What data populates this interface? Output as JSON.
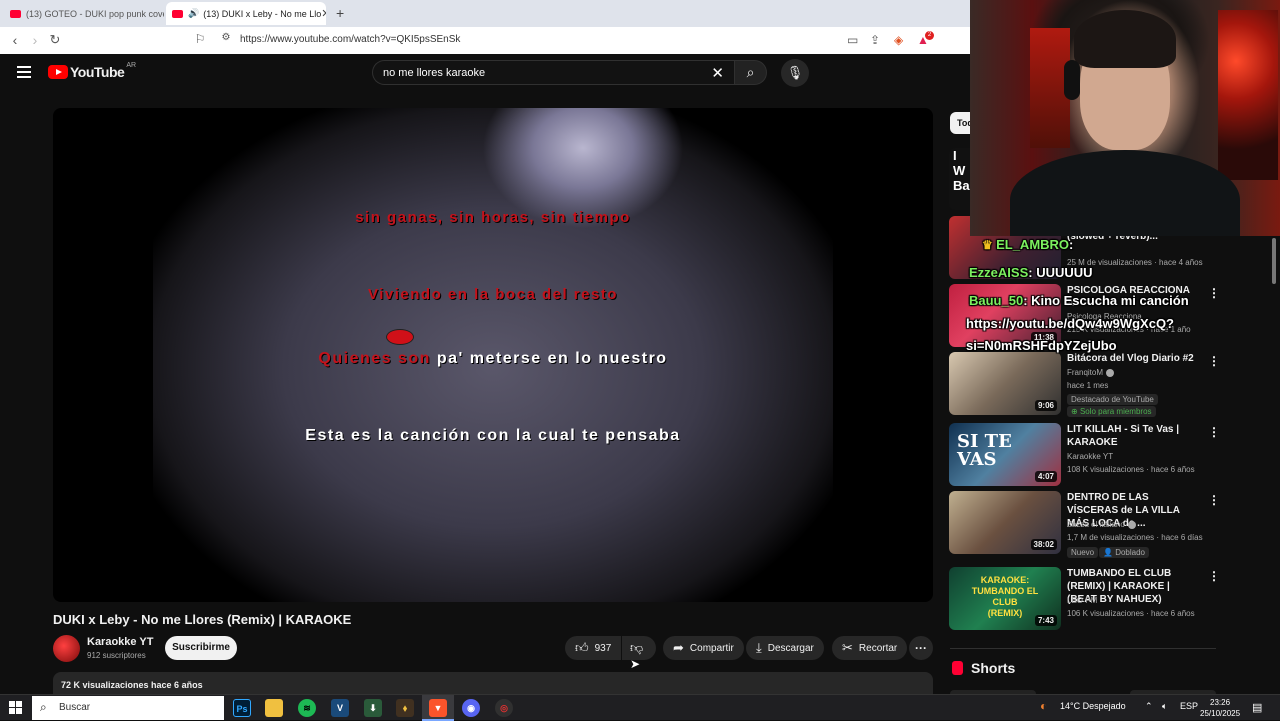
{
  "browser": {
    "tabs": [
      {
        "label": "(13) GOTEO - DUKI pop punk cover"
      },
      {
        "label": "(13) DUKI x Leby - No me Llo"
      }
    ],
    "new_tab": "+",
    "url": "https://www.youtube.com/watch?v=QKI5psSEnSk",
    "extension_badge": "2"
  },
  "youtube": {
    "logo_text": "YouTube",
    "country_code": "AR",
    "search_value": "no me llores karaoke"
  },
  "video": {
    "lyrics": [
      "sin ganas, sin horas, sin tiempo",
      "Viviendo en la boca del resto",
      "Quienes son pa' meterse en lo nuestro",
      "Esta es la canción con la cual te pensaba"
    ],
    "title": "DUKI x Leby - No me Llores (Remix) | KARAOKE",
    "channel": "Karaokke YT",
    "subscribers": "912 suscriptores",
    "subscribe_label": "Suscribirme",
    "likes": "937",
    "share_label": "Compartir",
    "download_label": "Descargar",
    "clip_label": "Recortar",
    "description_meta": "72 K visualizaciones  hace 6 años"
  },
  "sidebar": {
    "chip_label": "Tod",
    "partial_card_text": [
      "I W",
      "Ba"
    ],
    "recommendations": [
      {
        "title": "(slowed + reverb)...",
        "channel": "",
        "meta": "25 M de visualizaciones · hace 4 años",
        "duration": ""
      },
      {
        "title": "PSICOLOGA REACCIONA A",
        "channel": "Psicologa Reacciona",
        "meta": "215 K visualizaciones · hace 1 año",
        "duration": "11:38"
      },
      {
        "title": "Bitácora del Vlog Diario #2",
        "channel": "FranqitoM",
        "meta": "hace 1 mes",
        "badge1": "Destacado de YouTube",
        "badge2": "Solo para miembros",
        "duration": "9:06"
      },
      {
        "title": "LIT KILLAH - Si Te Vas | KARAOKE",
        "channel": "Karaokke YT",
        "meta": "108 K visualizaciones · hace 6 años",
        "duration": "4:07"
      },
      {
        "title": "DENTRO DE LAS VÍSCERAS de LA VILLA MÁS LOCA de ...",
        "channel": "Zazza el italiano",
        "meta": "1,7 M de visualizaciones · hace 6 días",
        "badge1": "Nuevo",
        "badge2": "Doblado",
        "duration": "38:02"
      },
      {
        "title": "TUMBANDO EL CLUB (REMIX) | KARAOKE | (BEAT BY NAHUEX)",
        "channel": "LEO PM",
        "meta": "106 K visualizaciones · hace 6 años",
        "duration": "7:43"
      }
    ],
    "shorts_label": "Shorts"
  },
  "chat": [
    {
      "user": "EL_AMBRO",
      "message": ":"
    },
    {
      "user": "EzzeAISS",
      "message": ": UUUUUU"
    },
    {
      "user": "Bauu_50",
      "message": ": Kino Escucha mi canción"
    },
    {
      "user": "",
      "message": "https://youtu.be/dQw4w9WgXcQ?"
    },
    {
      "user": "",
      "message": "si=N0mRSHFdpYZejUbo"
    }
  ],
  "taskbar": {
    "search_placeholder": "Buscar",
    "weather": "14°C  Despejado",
    "language": "ESP",
    "time": "23:26",
    "date": "25/10/2025"
  },
  "colors": {
    "yt_red": "#ff0000",
    "lyric_red": "#c4121b",
    "chat_user_green": "#7cf05f"
  }
}
